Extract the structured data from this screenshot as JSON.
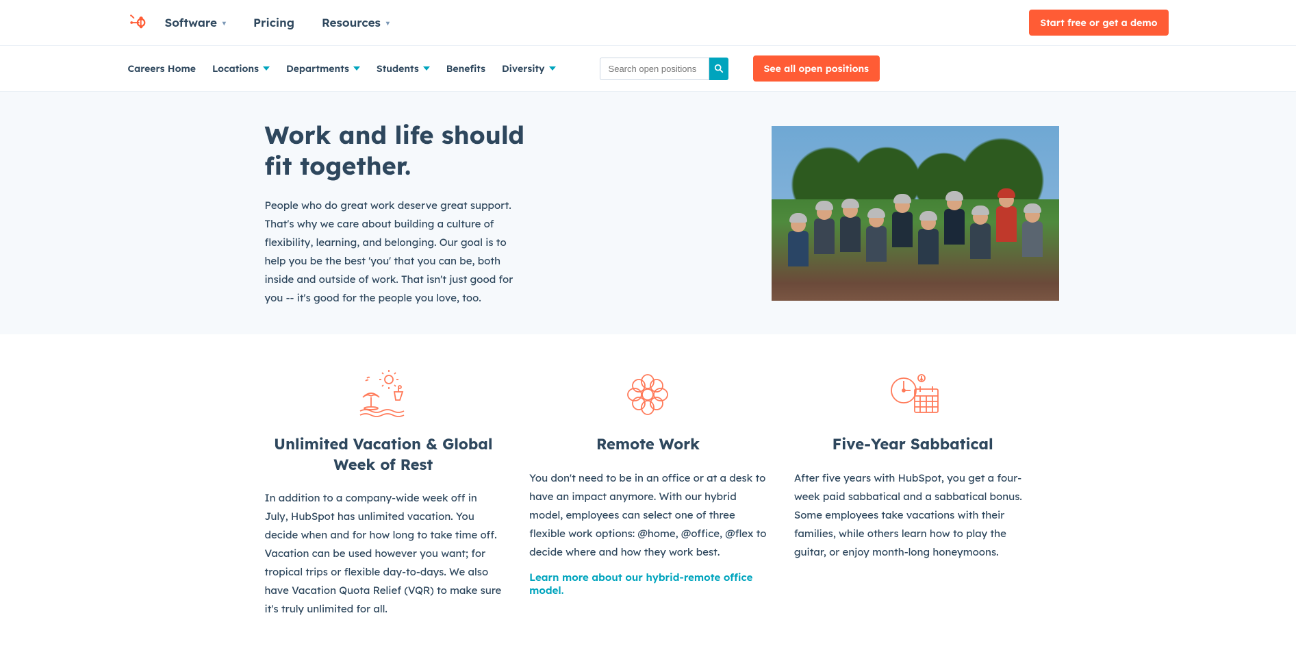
{
  "topnav": {
    "items": [
      {
        "label": "Software",
        "has_caret": true
      },
      {
        "label": "Pricing",
        "has_caret": false
      },
      {
        "label": "Resources",
        "has_caret": true
      }
    ],
    "cta": "Start free or get a demo"
  },
  "subnav": {
    "items": [
      {
        "label": "Careers Home",
        "has_caret": false
      },
      {
        "label": "Locations",
        "has_caret": true
      },
      {
        "label": "Departments",
        "has_caret": true
      },
      {
        "label": "Students",
        "has_caret": true
      },
      {
        "label": "Benefits",
        "has_caret": false
      },
      {
        "label": "Diversity",
        "has_caret": true
      }
    ],
    "search_placeholder": "Search open positions",
    "see_all": "See all open positions"
  },
  "hero": {
    "title": "Work and life should fit together.",
    "body": "People who do great work deserve great support. That's why we care about building a culture of flexibility, learning, and belonging. Our goal is to help you be the best 'you' that you can be, both inside and outside of work. That isn't just good for you -- it's good for the people you love, too."
  },
  "benefits": [
    {
      "title": "Unlimited Vacation & Global Week of Rest",
      "body": "In addition to a company-wide week off in July, HubSpot has unlimited vacation. You decide when and for how long to take time off. Vacation can be used however you want; for tropical trips or flexible day-to-days. We also have Vacation Quota Relief (VQR) to make sure it's truly unlimited for all."
    },
    {
      "title": "Remote Work",
      "body": "You don't need to be in an office or at a desk to have an impact anymore. With our hybrid model, employees can select one of three flexible work options: @home, @office, @flex to decide where and how they work best.",
      "link": "Learn more about our hybrid-remote office model."
    },
    {
      "title": "Five-Year Sabbatical",
      "body": "After five years with HubSpot, you get a four-week paid sabbatical and a sabbatical bonus. Some employees take vacations with their families, while others learn how to play the guitar, or enjoy month-long honeymoons."
    }
  ]
}
